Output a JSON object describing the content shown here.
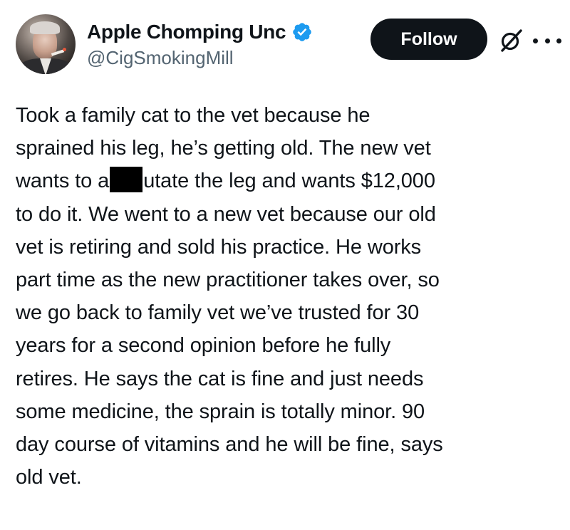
{
  "author": {
    "display_name": "Apple Chomping Unc",
    "handle": "@CigSmokingMill",
    "verified": true
  },
  "actions": {
    "follow_label": "Follow"
  },
  "colors": {
    "verified_blue": "#1d9bf0",
    "text_primary": "#0f1419",
    "text_secondary": "#536471",
    "follow_bg": "#0f1419"
  },
  "icons": [
    "verified-badge-icon",
    "grok-icon",
    "more-options-icon"
  ],
  "tweet": {
    "lines": {
      "l1": "Took a family cat to the vet because he",
      "l2": "sprained his leg, he’s getting old. The new vet",
      "l3_before": "wants to a",
      "l3_after": "utate the leg and wants $12,000",
      "l4": "to do it. We went to a new vet because our old",
      "l5": "vet is retiring and sold his practice. He works",
      "l6": "part time as the new practitioner takes over, so",
      "l7": "we go back to family vet we’ve trusted for 30",
      "l8": "years for a second opinion before he fully",
      "l9": "retires. He says the cat is fine and just needs",
      "l10": "some medicine, the sprain is totally minor. 90",
      "l11": "day course of vitamins and he will be fine, says",
      "l12": "old vet."
    }
  }
}
